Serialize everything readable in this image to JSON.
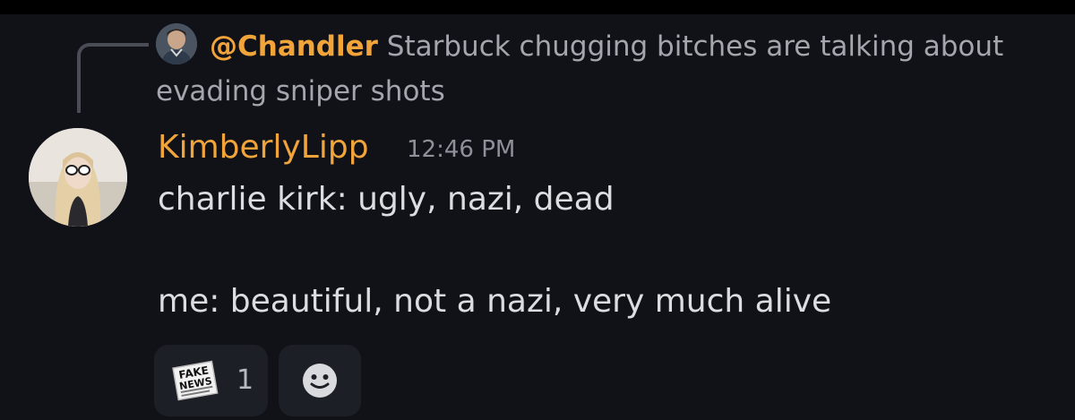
{
  "reply": {
    "author": "@Chandler",
    "text": "Starbuck chugging bitches are talking about evading sniper shots"
  },
  "message": {
    "author": "KimberlyLipp",
    "timestamp": "12:46 PM",
    "lines": [
      "charlie kirk: ugly, nazi, dead",
      "me: beautiful, not a nazi, very much alive"
    ]
  },
  "reactions": [
    {
      "emoji": "fake-news-stamp",
      "sticker_text": "FAKE NEWS",
      "count": "1"
    }
  ],
  "colors": {
    "background": "#111118",
    "author": "#f0a43a",
    "reply_text": "#a3a6ad",
    "message_text": "#dcdde1",
    "timestamp": "#8e9199",
    "reaction_bg": "#1d1f27"
  }
}
